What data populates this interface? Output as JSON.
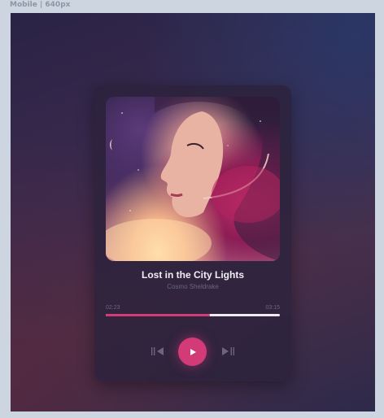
{
  "frame": {
    "label": "Mobile | 640px"
  },
  "player": {
    "title": "Lost in the City Lights",
    "artist": "Cosmo Sheldrake",
    "current_time": "02:23",
    "duration": "03:15",
    "progress": 0.6,
    "accent": "#d33a78",
    "controls": {
      "previous_icon": "skip-previous-icon",
      "play_icon": "play-icon",
      "next_icon": "skip-next-icon"
    }
  }
}
